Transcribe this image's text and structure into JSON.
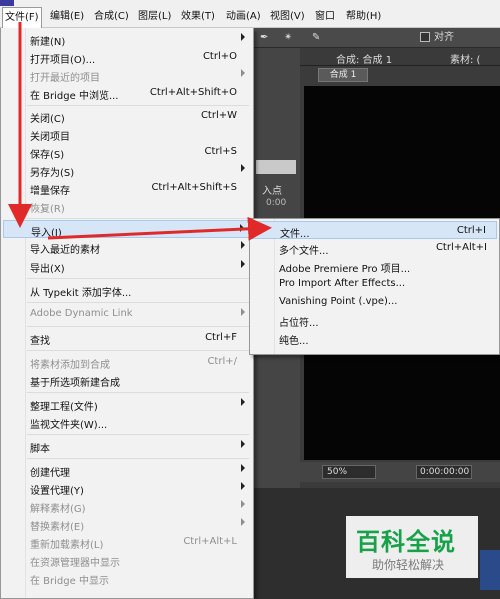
{
  "menubar": {
    "items": [
      "文件(F)",
      "编辑(E)",
      "合成(C)",
      "图层(L)",
      "效果(T)",
      "动画(A)",
      "视图(V)",
      "窗口",
      "帮助(H)"
    ]
  },
  "toolbar": {
    "snap_label": "对齐"
  },
  "comp_panel": {
    "header_title": "合成: 合成 1",
    "header_right": "素材: (",
    "tab_label": "合成 1",
    "zoom_value": "50%",
    "timecode": "0:00:00:00"
  },
  "project_panel": {
    "in_point_label": "入点",
    "time_value": "0:00"
  },
  "file_menu": {
    "items": [
      {
        "label": "新建(N)",
        "shortcut": "",
        "submenu": true,
        "enabled": true
      },
      {
        "label": "打开项目(O)...",
        "shortcut": "Ctrl+O",
        "submenu": false,
        "enabled": true
      },
      {
        "label": "打开最近的项目",
        "shortcut": "",
        "submenu": true,
        "enabled": false
      },
      {
        "label": "在 Bridge 中浏览...",
        "shortcut": "Ctrl+Alt+Shift+O",
        "submenu": false,
        "enabled": true
      },
      {
        "label": "关闭(C)",
        "shortcut": "Ctrl+W",
        "submenu": false,
        "enabled": true
      },
      {
        "label": "关闭项目",
        "shortcut": "",
        "submenu": false,
        "enabled": true
      },
      {
        "label": "保存(S)",
        "shortcut": "Ctrl+S",
        "submenu": false,
        "enabled": true
      },
      {
        "label": "另存为(S)",
        "shortcut": "",
        "submenu": true,
        "enabled": true
      },
      {
        "label": "增量保存",
        "shortcut": "Ctrl+Alt+Shift+S",
        "submenu": false,
        "enabled": true
      },
      {
        "label": "恢复(R)",
        "shortcut": "",
        "submenu": false,
        "enabled": false
      },
      {
        "label": "导入(I)",
        "shortcut": "",
        "submenu": true,
        "enabled": true
      },
      {
        "label": "导入最近的素材",
        "shortcut": "",
        "submenu": true,
        "enabled": true
      },
      {
        "label": "导出(X)",
        "shortcut": "",
        "submenu": true,
        "enabled": true
      },
      {
        "label": "从 Typekit 添加字体...",
        "shortcut": "",
        "submenu": false,
        "enabled": true
      },
      {
        "label": "Adobe Dynamic Link",
        "shortcut": "",
        "submenu": true,
        "enabled": false
      },
      {
        "label": "查找",
        "shortcut": "Ctrl+F",
        "submenu": false,
        "enabled": true
      },
      {
        "label": "将素材添加到合成",
        "shortcut": "Ctrl+/",
        "submenu": false,
        "enabled": false
      },
      {
        "label": "基于所选项新建合成",
        "shortcut": "",
        "submenu": false,
        "enabled": true
      },
      {
        "label": "整理工程(文件)",
        "shortcut": "",
        "submenu": true,
        "enabled": true
      },
      {
        "label": "监视文件夹(W)...",
        "shortcut": "",
        "submenu": false,
        "enabled": true
      },
      {
        "label": "脚本",
        "shortcut": "",
        "submenu": true,
        "enabled": true
      },
      {
        "label": "创建代理",
        "shortcut": "",
        "submenu": true,
        "enabled": true
      },
      {
        "label": "设置代理(Y)",
        "shortcut": "",
        "submenu": true,
        "enabled": true
      },
      {
        "label": "解释素材(G)",
        "shortcut": "",
        "submenu": true,
        "enabled": false
      },
      {
        "label": "替换素材(E)",
        "shortcut": "",
        "submenu": true,
        "enabled": false
      },
      {
        "label": "重新加载素材(L)",
        "shortcut": "Ctrl+Alt+L",
        "submenu": false,
        "enabled": false
      },
      {
        "label": "在资源管理器中显示",
        "shortcut": "",
        "submenu": false,
        "enabled": false
      },
      {
        "label": "在 Bridge 中显示",
        "shortcut": "",
        "submenu": false,
        "enabled": false
      }
    ]
  },
  "import_menu": {
    "items": [
      {
        "label": "文件...",
        "shortcut": "Ctrl+I"
      },
      {
        "label": "多个文件...",
        "shortcut": "Ctrl+Alt+I"
      },
      {
        "label": "Adobe Premiere Pro 项目...",
        "shortcut": ""
      },
      {
        "label": "Pro Import After Effects...",
        "shortcut": ""
      },
      {
        "label": "Vanishing Point (.vpe)...",
        "shortcut": ""
      },
      {
        "label": "占位符...",
        "shortcut": ""
      },
      {
        "label": "纯色...",
        "shortcut": ""
      }
    ]
  },
  "watermark": {
    "title": "百科全说",
    "subtitle": "助你轻松解决"
  },
  "colors": {
    "highlight": "#d6e6f7",
    "arrow": "#e02a2a",
    "watermark_green": "#17a24a"
  }
}
